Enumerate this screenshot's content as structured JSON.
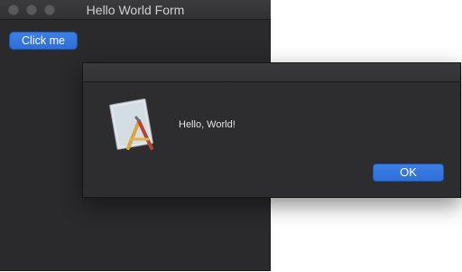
{
  "main_window": {
    "title": "Hello World Form",
    "button_label": "Click me"
  },
  "dialog": {
    "message": "Hello, World!",
    "ok_label": "OK",
    "icon": "app-builder-icon"
  },
  "colors": {
    "accent": "#2f6fd8",
    "window_bg": "#2a2a2c",
    "dialog_bg": "#2d2d2f"
  }
}
